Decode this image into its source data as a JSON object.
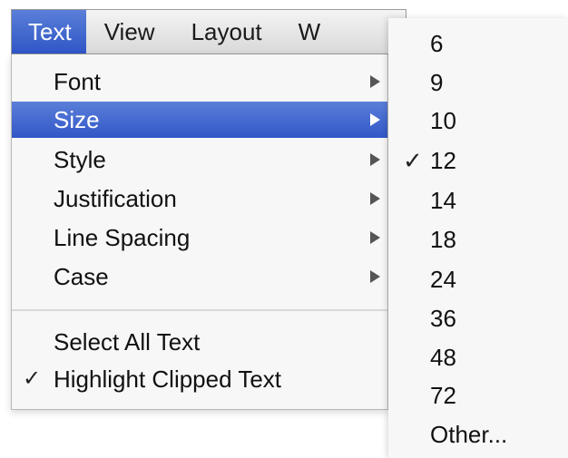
{
  "menubar": {
    "items": [
      {
        "label": "Text"
      },
      {
        "label": "View"
      },
      {
        "label": "Layout"
      },
      {
        "label": "W"
      }
    ]
  },
  "text_menu": {
    "items": [
      {
        "label": "Font"
      },
      {
        "label": "Size"
      },
      {
        "label": "Style"
      },
      {
        "label": "Justification"
      },
      {
        "label": "Line Spacing"
      },
      {
        "label": "Case"
      },
      {
        "label": "Select All Text"
      },
      {
        "label": "Highlight Clipped Text"
      }
    ],
    "check_glyph": "✓"
  },
  "size_submenu": {
    "items": [
      {
        "label": "6"
      },
      {
        "label": "9"
      },
      {
        "label": "10"
      },
      {
        "label": "12"
      },
      {
        "label": "14"
      },
      {
        "label": "18"
      },
      {
        "label": "24"
      },
      {
        "label": "36"
      },
      {
        "label": "48"
      },
      {
        "label": "72"
      },
      {
        "label": "Other..."
      }
    ],
    "check_glyph": "✓"
  },
  "colors": {
    "highlight": "#3157c7",
    "menu_bg": "#f7f7f7"
  }
}
